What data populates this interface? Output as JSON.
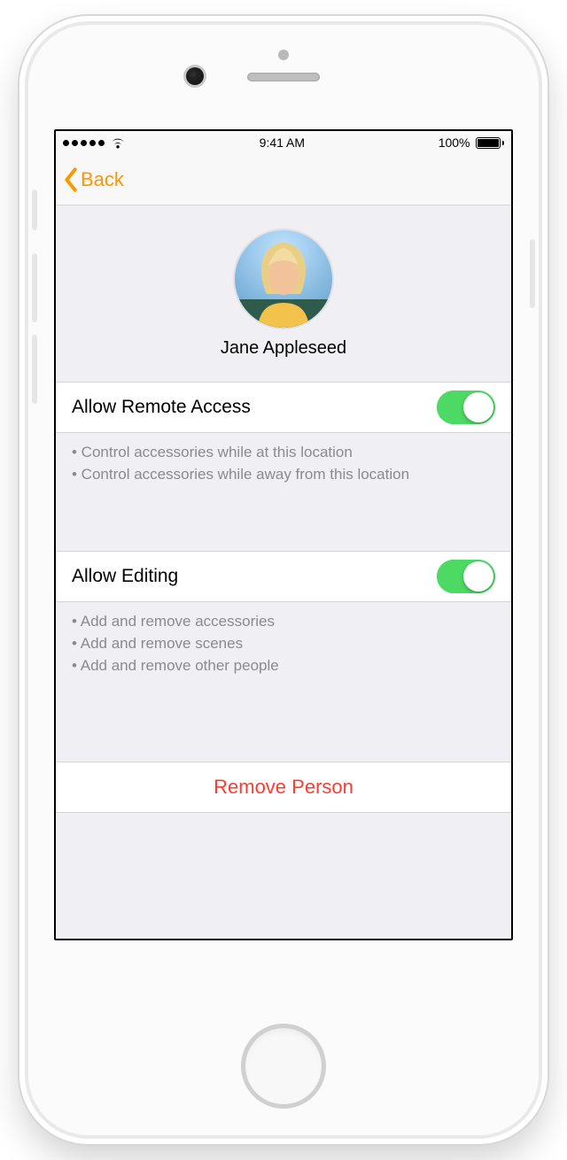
{
  "statusbar": {
    "time": "9:41 AM",
    "battery_pct": "100%"
  },
  "nav": {
    "back_label": "Back"
  },
  "profile": {
    "name": "Jane Appleseed"
  },
  "sections": {
    "remote": {
      "title": "Allow Remote Access",
      "toggle_on": true,
      "footer": [
        "• Control accessories while at this location",
        "• Control accessories while away from this location"
      ]
    },
    "editing": {
      "title": "Allow Editing",
      "toggle_on": true,
      "footer": [
        "• Add and remove accessories",
        "• Add and remove scenes",
        "• Add and remove other people"
      ]
    }
  },
  "actions": {
    "remove_label": "Remove Person"
  }
}
